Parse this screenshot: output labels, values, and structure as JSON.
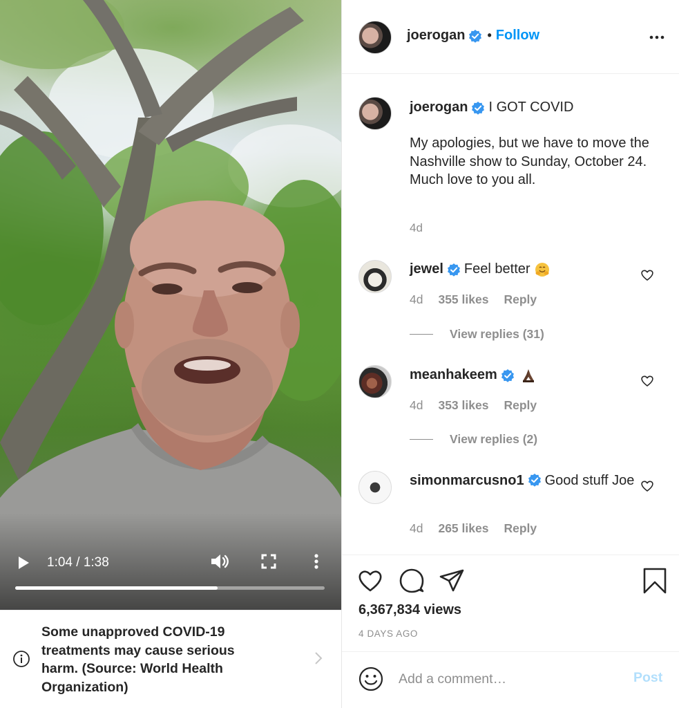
{
  "video": {
    "time_display": "1:04 / 1:38",
    "progress": 0.653,
    "icons": {
      "play": "play-icon",
      "volume": "volume-icon",
      "fullscreen": "fullscreen-icon",
      "more": "more-vertical-icon"
    }
  },
  "banner": {
    "text": "Some unapproved COVID-19 treatments may cause serious harm. (Source: World Health Organization)",
    "icons": {
      "info": "info-icon",
      "chevron": "chevron-right-icon"
    }
  },
  "header": {
    "username": "joerogan",
    "dot": "•",
    "follow_label": "Follow"
  },
  "caption": {
    "username": "joerogan",
    "title": "I GOT COVID",
    "body": "My apologies, but we have to move the Nashville show to Sunday, October 24.\nMuch love to you all.",
    "time": "4d"
  },
  "comments": [
    {
      "username": "jewel",
      "text": "Feel better",
      "emoji": "hugging-face",
      "time": "4d",
      "likes": "355 likes",
      "reply": "Reply",
      "view_replies": "View replies (31)"
    },
    {
      "username": "meanhakeem",
      "text": "",
      "emoji": "folded-hands",
      "time": "4d",
      "likes": "353 likes",
      "reply": "Reply",
      "view_replies": "View replies (2)"
    },
    {
      "username": "simonmarcusno1",
      "text": "Good stuff Joe",
      "time": "4d",
      "likes": "265 likes",
      "reply": "Reply"
    }
  ],
  "stats": {
    "views": "6,367,834 views",
    "posted": "4 DAYS AGO"
  },
  "add_comment": {
    "placeholder": "Add a comment…",
    "post_label": "Post"
  },
  "colors": {
    "accent": "#0095f6",
    "verified": "#3897f0",
    "muted": "#8e8e8e",
    "post_disabled": "#b2dffc"
  }
}
